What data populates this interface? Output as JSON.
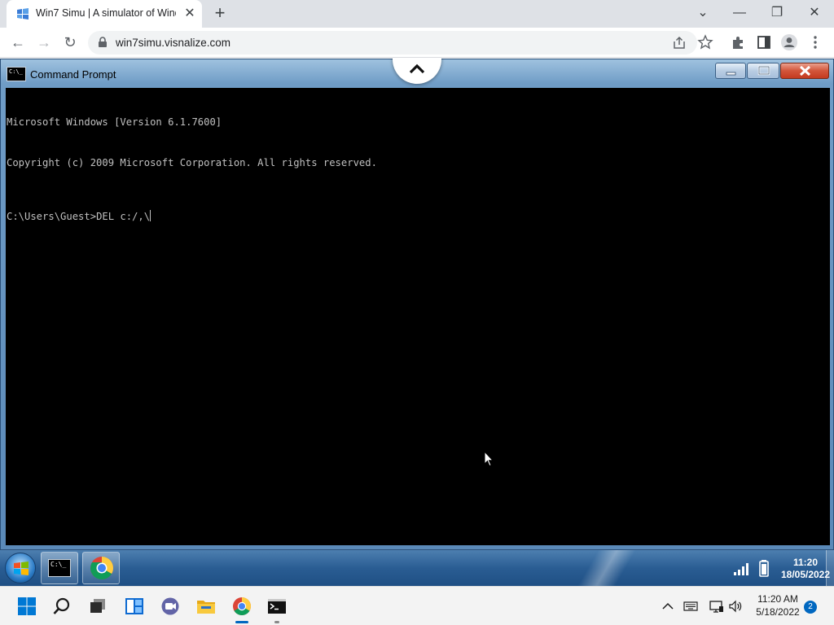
{
  "browser": {
    "tab_title": "Win7 Simu | A simulator of Windows 7",
    "url": "win7simu.visnalize.com",
    "tab_close_glyph": "✕",
    "new_tab_glyph": "+",
    "window_controls": {
      "tab_search": "⌄",
      "minimize": "—",
      "restore": "❐",
      "close": "✕"
    },
    "nav": {
      "back": "←",
      "forward": "→",
      "reload": "↻"
    }
  },
  "cmd_window": {
    "title": "Command Prompt",
    "icon_glyph": "C:\\_",
    "lines": [
      "Microsoft Windows [Version 6.1.7600]",
      "Copyright (c) 2009 Microsoft Corporation. All rights reserved."
    ],
    "prompt": "C:\\Users\\Guest>",
    "input": "DEL c:/,\\"
  },
  "win7_taskbar": {
    "pinned": [
      "command-prompt",
      "google-chrome"
    ],
    "clock_time": "11:20",
    "clock_date": "18/05/2022"
  },
  "win11_taskbar": {
    "apps": [
      "start",
      "search",
      "task-view",
      "widgets",
      "teams-chat",
      "file-explorer",
      "chrome",
      "terminal"
    ],
    "tray_time": "11:20 AM",
    "tray_date": "5/18/2022",
    "notification_count": "2"
  },
  "colors": {
    "cmd_bg": "#000000",
    "cmd_text": "#c0c0c0",
    "win7_taskbar": "#2a5d93",
    "accent": "#0067c0"
  }
}
